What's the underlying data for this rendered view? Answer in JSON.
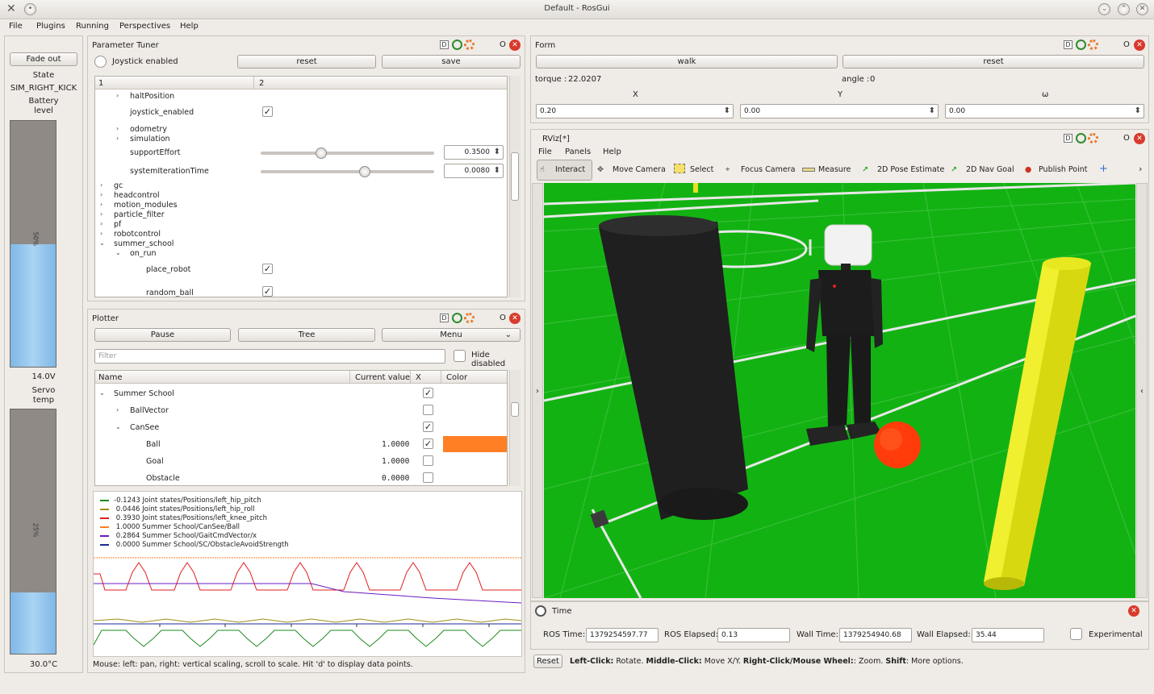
{
  "window": {
    "title": "Default - RosGui"
  },
  "menu": [
    "File",
    "Plugins",
    "Running",
    "Perspectives",
    "Help"
  ],
  "left": {
    "fade_out": "Fade out",
    "state_label": "State",
    "state_value": "SIM_RIGHT_KICK",
    "battery_label_1": "Battery",
    "battery_label_2": "level",
    "battery_pct": "50%",
    "battery_level": 0.5,
    "battery_voltage": "14.0V",
    "servo_label_1": "Servo",
    "servo_label_2": "temp",
    "servo_pct": "25%",
    "servo_level": 0.25,
    "servo_temp": "30.0°C"
  },
  "param": {
    "title": "Parameter Tuner",
    "joystick": "Joystick enabled",
    "reset": "reset",
    "save": "save",
    "col1": "1",
    "col2": "2",
    "rows": {
      "halt": "haltPosition",
      "joystick_enabled": "joystick_enabled",
      "odometry": "odometry",
      "simulation": "simulation",
      "support": "supportEffort",
      "support_val": "0.3500",
      "support_level": 0.35,
      "sysiter": "systemIterationTime",
      "sysiter_val": "0.0080",
      "sysiter_level": 0.6,
      "gc": "gc",
      "headcontrol": "headcontrol",
      "motion_modules": "motion_modules",
      "particle_filter": "particle_filter",
      "pf": "pf",
      "robotcontrol": "robotcontrol",
      "summer_school": "summer_school",
      "on_run": "on_run",
      "place_robot": "place_robot",
      "random_ball": "random_ball"
    }
  },
  "plotter": {
    "title": "Plotter",
    "pause": "Pause",
    "tree": "Tree",
    "menu": "Menu",
    "filter_placeholder": "Filter",
    "hide_disabled": "Hide disabled",
    "cols": {
      "name": "Name",
      "value": "Current value",
      "x": "X",
      "color": "Color"
    },
    "rows": [
      {
        "name": "Summer School",
        "value": ""
      },
      {
        "name": "BallVector",
        "value": ""
      },
      {
        "name": "CanSee",
        "value": ""
      },
      {
        "name": "Ball",
        "value": "1.0000"
      },
      {
        "name": "Goal",
        "value": "1.0000"
      },
      {
        "name": "Obstacle",
        "value": "0.0000"
      }
    ],
    "legend": [
      {
        "value": "-0.1243",
        "label": "Joint states/Positions/left_hip_pitch",
        "color": "#1c8a1c"
      },
      {
        "value": "0.0446",
        "label": "Joint states/Positions/left_hip_roll",
        "color": "#9c9018"
      },
      {
        "value": "0.3930",
        "label": "Joint states/Positions/left_knee_pitch",
        "color": "#e01c1c"
      },
      {
        "value": "1.0000",
        "label": "Summer School/CanSee/Ball",
        "color": "#ff7f24"
      },
      {
        "value": "0.2864",
        "label": "Summer School/GaitCmdVector/x",
        "color": "#6a1cc0"
      },
      {
        "value": "0.0000",
        "label": "Summer School/SC/ObstacleAvoidStrength",
        "color": "#1c2aa0"
      }
    ],
    "status": "Mouse: left: pan, right: vertical scaling, scroll to scale. Hit 'd' to display data points."
  },
  "form": {
    "title": "Form",
    "walk": "walk",
    "reset": "reset",
    "torque_label": "torque :",
    "torque_val": "22.0207",
    "angle_label": "angle :",
    "angle_val": "0",
    "x": "X",
    "y": "Y",
    "w": "ω",
    "xval": "0.20",
    "yval": "0.00",
    "wval": "0.00"
  },
  "rviz": {
    "title": "RViz[*]",
    "menu": [
      "File",
      "Panels",
      "Help"
    ],
    "tools": [
      "Interact",
      "Move Camera",
      "Select",
      "Focus Camera",
      "Measure",
      "2D Pose Estimate",
      "2D Nav Goal",
      "Publish Point"
    ]
  },
  "time": {
    "title": "Time",
    "ros_time_label": "ROS Time:",
    "ros_time": "1379254597.77",
    "ros_elapsed_label": "ROS Elapsed:",
    "ros_elapsed": "0.13",
    "wall_time_label": "Wall Time:",
    "wall_time": "1379254940.68",
    "wall_elapsed_label": "Wall Elapsed:",
    "wall_elapsed": "35.44",
    "experimental": "Experimental"
  },
  "hint": {
    "reset": "Reset",
    "left": "Left-Click:",
    "left_t": " Rotate. ",
    "middle": "Middle-Click:",
    "middle_t": " Move X/Y. ",
    "right": "Right-Click/Mouse Wheel:",
    "right_t": ": Zoom. ",
    "shift": "Shift",
    "shift_t": ": More options."
  },
  "panel_ctl": {
    "d": "D",
    "o": "O"
  }
}
